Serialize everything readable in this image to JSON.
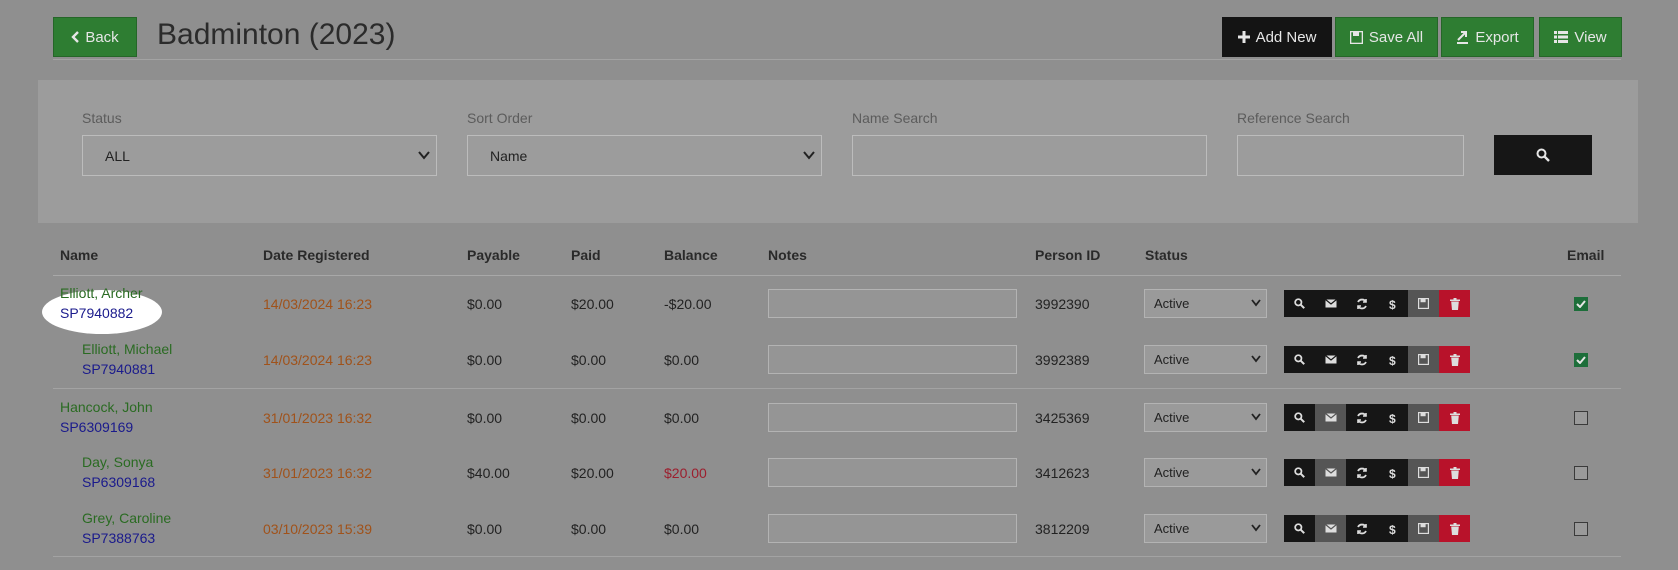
{
  "header": {
    "back_label": "Back",
    "title": "Badminton (2023)",
    "add_label": "Add New",
    "save_label": "Save All",
    "export_label": "Export",
    "view_label": "View"
  },
  "filters": {
    "status_label": "Status",
    "status_value": "ALL",
    "sort_label": "Sort Order",
    "sort_value": "Name",
    "name_label": "Name Search",
    "name_value": "",
    "ref_label": "Reference Search",
    "ref_value": ""
  },
  "columns": [
    "Name",
    "Date Registered",
    "Payable",
    "Paid",
    "Balance",
    "Notes",
    "Person ID",
    "Status",
    "Email"
  ],
  "rows": [
    {
      "name": "Elliott, Archer",
      "ref": "SP7940882",
      "date": "14/03/2024 16:23",
      "payable": "$0.00",
      "paid": "$20.00",
      "balance": "-$20.00",
      "notes": "",
      "person_id": "3992390",
      "status": "Active",
      "email": true
    },
    {
      "name": "Elliott, Michael",
      "ref": "SP7940881",
      "date": "14/03/2024 16:23",
      "payable": "$0.00",
      "paid": "$0.00",
      "balance": "$0.00",
      "notes": "",
      "person_id": "3992389",
      "status": "Active",
      "email": true
    },
    {
      "name": "Hancock, John",
      "ref": "SP6309169",
      "date": "31/01/2023 16:32",
      "payable": "$0.00",
      "paid": "$0.00",
      "balance": "$0.00",
      "notes": "",
      "person_id": "3425369",
      "status": "Active",
      "email": false
    },
    {
      "name": "Day, Sonya",
      "ref": "SP6309168",
      "date": "31/01/2023 16:32",
      "payable": "$40.00",
      "paid": "$20.00",
      "balance": "$20.00",
      "notes": "",
      "person_id": "3412623",
      "status": "Active",
      "email": false
    },
    {
      "name": "Grey, Caroline",
      "ref": "SP7388763",
      "date": "03/10/2023 15:39",
      "payable": "$0.00",
      "paid": "$0.00",
      "balance": "$0.00",
      "notes": "",
      "person_id": "3812209",
      "status": "Active",
      "email": false
    }
  ],
  "colors": {
    "accent_green": "#2e7d32",
    "delete_red": "#b8122a",
    "name_green": "#2a6b22",
    "ref_blue": "#1a1a8c",
    "date_orange": "#a0521a"
  }
}
